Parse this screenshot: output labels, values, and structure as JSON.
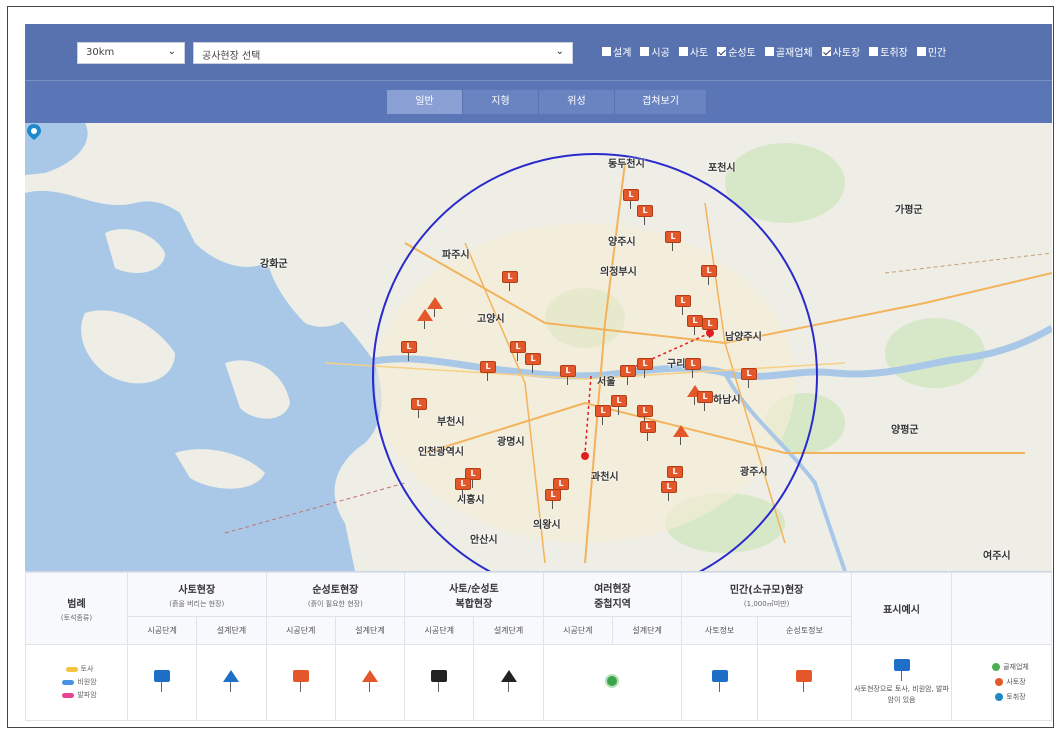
{
  "controls": {
    "radius_value": "30km",
    "site_placeholder": "공사현장 선택",
    "filters": [
      {
        "label": "설계",
        "checked": false
      },
      {
        "label": "시공",
        "checked": false
      },
      {
        "label": "사토",
        "checked": false
      },
      {
        "label": "순성토",
        "checked": true
      },
      {
        "label": "골재업체",
        "checked": false
      },
      {
        "label": "사토장",
        "checked": true
      },
      {
        "label": "토취장",
        "checked": false
      },
      {
        "label": "민간",
        "checked": false
      }
    ]
  },
  "tabs": [
    {
      "label": "일반",
      "active": true
    },
    {
      "label": "지형",
      "active": false
    },
    {
      "label": "위성",
      "active": false
    },
    {
      "label": "겹쳐보기",
      "active": false
    }
  ],
  "map": {
    "center_label": "서울",
    "cities": [
      "동두천시",
      "포천시",
      "가평군",
      "양주시",
      "의정부시",
      "파주시",
      "강화군",
      "고양시",
      "남양주시",
      "구리시",
      "하남시",
      "부천시",
      "인천광역시",
      "광명시",
      "과천시",
      "광주시",
      "시흥시",
      "의왕시",
      "양평군",
      "여주시",
      "안산시"
    ]
  },
  "legend": {
    "title": "범례",
    "title_sub": "(토석종류)",
    "groups": [
      {
        "title": "사토현장",
        "sub": "(흙을 버리는 현장)"
      },
      {
        "title": "순성토현장",
        "sub": "(흙이 필요한 현장)"
      },
      {
        "title": "사토/순성토",
        "sub": "복합현장"
      },
      {
        "title": "여러현장",
        "sub": "중첩지역"
      },
      {
        "title": "민간(소규모)현장",
        "sub": "(1,000㎥미만)"
      }
    ],
    "display_example_title": "표시예시",
    "phases": [
      "시공단계",
      "설계단계",
      "시공단계",
      "설계단계",
      "시공단계",
      "설계단계",
      "시공단계",
      "설계단계",
      "사토정보",
      "순성토정보"
    ],
    "soil_types": [
      {
        "label": "토사",
        "color": "#f2c53d"
      },
      {
        "label": "비원암",
        "color": "#4a90e2"
      },
      {
        "label": "발파암",
        "color": "#e84393"
      }
    ],
    "example_text": "사토현장으로 토사, 비원암, 발파암이 있음",
    "place_types": [
      {
        "label": "골재업체",
        "color": "#4caf50"
      },
      {
        "label": "사토장",
        "color": "#e3572b"
      },
      {
        "label": "토취장",
        "color": "#1e88c8"
      }
    ]
  },
  "colors": {
    "header_bg": "#5872b0",
    "tab_active": "#8aa0d4",
    "circle": "#2a2acc",
    "marker_orange": "#e3572b",
    "route_red": "#e02020"
  }
}
